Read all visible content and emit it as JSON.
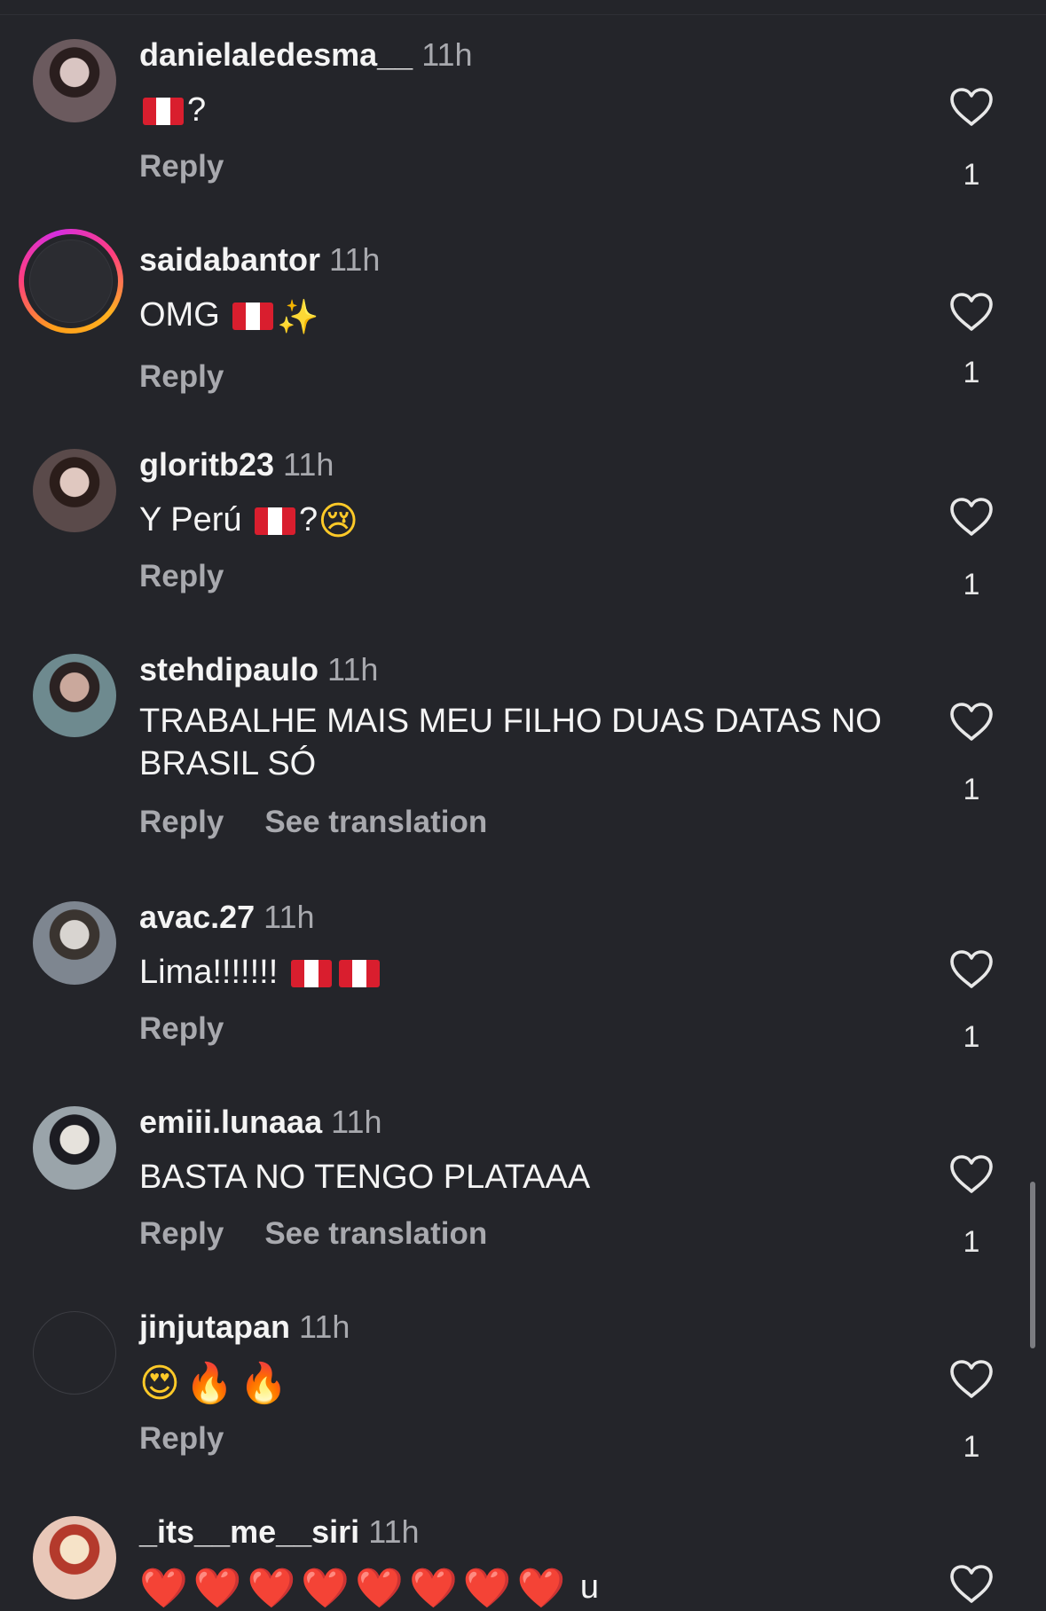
{
  "comments": [
    {
      "username": "danielaledesma__",
      "time": "11h",
      "parts": [
        "[PE]",
        "?"
      ],
      "reply": "Reply",
      "see_translation": "",
      "likes": "1",
      "avatar": "photo"
    },
    {
      "username": "saidabantor",
      "time": "11h",
      "parts": [
        "OMG ",
        "[PE]",
        " ✨"
      ],
      "reply": "Reply",
      "see_translation": "",
      "likes": "1",
      "avatar": "ring"
    },
    {
      "username": "gloritb23",
      "time": "11h",
      "parts": [
        "Y Perú ",
        "[PE]",
        "?",
        "😢"
      ],
      "reply": "Reply",
      "see_translation": "",
      "likes": "1",
      "avatar": "photo"
    },
    {
      "username": "stehdipaulo",
      "time": "11h",
      "parts": [
        "TRABALHE MAIS MEU FILHO DUAS DATAS NO BRASIL SÓ"
      ],
      "reply": "Reply",
      "see_translation": "See translation",
      "likes": "1",
      "avatar": "photo"
    },
    {
      "username": "avac.27",
      "time": "11h",
      "parts": [
        "Lima!!!!!!! ",
        "[PE]",
        "[PE]"
      ],
      "reply": "Reply",
      "see_translation": "",
      "likes": "1",
      "avatar": "photo"
    },
    {
      "username": "emiii.lunaaa",
      "time": "11h",
      "parts": [
        "BASTA NO TENGO PLATAAA"
      ],
      "reply": "Reply",
      "see_translation": "See translation",
      "likes": "1",
      "avatar": "photo"
    },
    {
      "username": "jinjutapan",
      "time": "11h",
      "parts": [
        "😍",
        "🔥",
        "🔥"
      ],
      "reply": "Reply",
      "see_translation": "",
      "likes": "1",
      "avatar": "empty"
    },
    {
      "username": "_its__me__siri",
      "time": "11h",
      "parts": [
        "❤️",
        "❤️",
        "❤️",
        "❤️",
        "❤️",
        "❤️",
        "❤️",
        "❤️",
        " u"
      ],
      "reply": "",
      "see_translation": "",
      "likes": "",
      "avatar": "photo"
    }
  ],
  "colors": {
    "background": "#24252a",
    "muted": "#a8a9ae",
    "text": "#f4f4f4",
    "heart_outline": "#e8e8e8",
    "flag_red": "#d91e2e"
  },
  "icons": {
    "like": "heart-outline-icon",
    "flag": "peru-flag-icon"
  }
}
